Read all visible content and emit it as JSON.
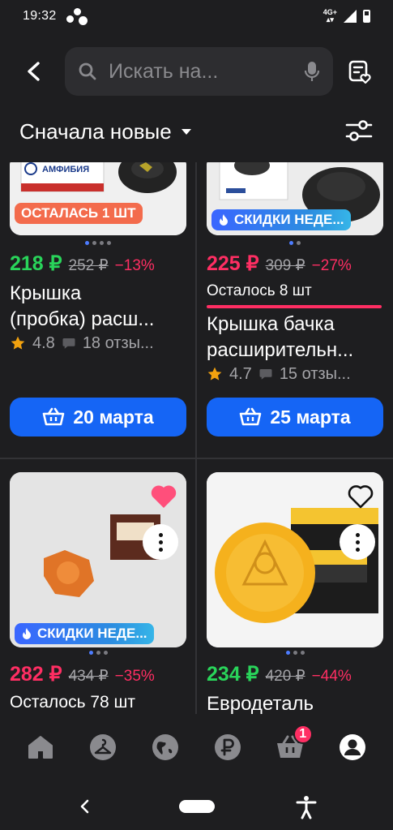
{
  "status_bar": {
    "time": "19:32",
    "network": "4G+"
  },
  "header": {
    "search_placeholder": "Искать на..."
  },
  "sort": {
    "label": "Сначала новые"
  },
  "products": [
    {
      "badge": "ОСТАЛАСЬ 1 ШТ",
      "price": "218 ₽",
      "old_price": "252 ₽",
      "discount": "−13%",
      "title": "Крышка",
      "title_line2": "(пробка) расш...",
      "rating": "4.8",
      "reviews": "18 отзы...",
      "delivery": "20 марта"
    },
    {
      "badge": "СКИДКИ НЕДЕ...",
      "price": "225 ₽",
      "old_price": "309 ₽",
      "discount": "−27%",
      "stock": "Осталось 8 шт",
      "title": "Крышка бачка",
      "title_line2": "расширительн...",
      "rating": "4.7",
      "reviews": "15 отзы...",
      "delivery": "25 марта"
    },
    {
      "badge": "СКИДКИ НЕДЕ...",
      "price": "282 ₽",
      "old_price": "434 ₽",
      "discount": "−35%",
      "stock": "Осталось 78 шт",
      "favorited": true
    },
    {
      "price": "234 ₽",
      "old_price": "420 ₽",
      "discount": "−44%",
      "title": "Евродеталь",
      "favorited": false
    }
  ],
  "bottom_nav": {
    "items": [
      "home-icon",
      "catalog-icon",
      "globe-icon",
      "ruble-icon",
      "cart-icon",
      "profile-icon"
    ],
    "cart_count": "1"
  },
  "colors": {
    "background": "#1e1e20",
    "accent_blue": "#1565f5",
    "price_green": "#29d45a",
    "price_red": "#ff2e63"
  }
}
